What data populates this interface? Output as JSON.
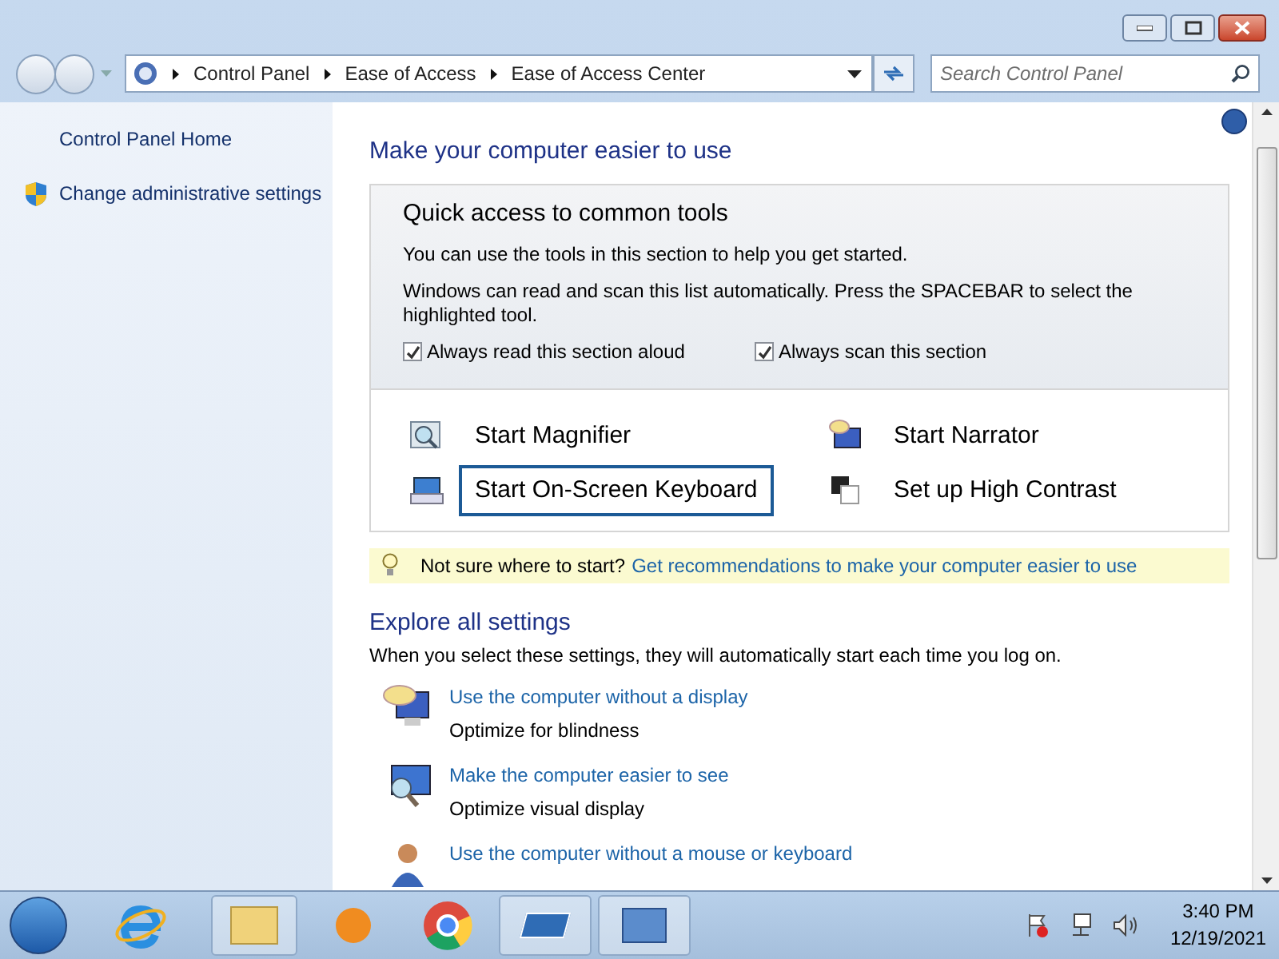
{
  "breadcrumb": [
    "Control Panel",
    "Ease of Access",
    "Ease of Access Center"
  ],
  "search": {
    "placeholder": "Search Control Panel"
  },
  "sidebar": {
    "items": [
      {
        "label": "Control Panel Home",
        "shield": false
      },
      {
        "label": "Change administrative settings",
        "shield": true
      }
    ]
  },
  "heading": "Make your computer easier to use",
  "quick_access": {
    "title": "Quick access to common tools",
    "text_1": "You can use the tools in this section to help you get started.",
    "text_2": "Windows can read and scan this list automatically.  Press the SPACEBAR to select the highlighted tool.",
    "options": [
      {
        "label": "Always read this section aloud",
        "checked": true
      },
      {
        "label": "Always scan this section",
        "checked": true
      }
    ],
    "tools": [
      {
        "label": "Start Magnifier",
        "kind": "magnifier",
        "selected": false
      },
      {
        "label": "Start Narrator",
        "kind": "narrator",
        "selected": false
      },
      {
        "label": "Start On-Screen Keyboard",
        "kind": "keyboard",
        "selected": true
      },
      {
        "label": "Set up High Contrast",
        "kind": "contrast",
        "selected": false
      }
    ]
  },
  "tip": {
    "text": "Not sure where to start?",
    "link": "Get recommendations to make your computer easier to use"
  },
  "explore": {
    "title": "Explore all settings",
    "text": "When you select these settings, they will automatically start each time you log on.",
    "items": [
      {
        "link": "Use the computer without a display",
        "description": "Optimize for blindness",
        "kind": "display"
      },
      {
        "link": "Make the computer easier to see",
        "description": "Optimize visual display",
        "kind": "see"
      },
      {
        "link": "Use the computer without a mouse or keyboard",
        "kind": "person"
      }
    ]
  },
  "clock": {
    "time": "3:40 PM",
    "date": "12/19/2021"
  }
}
